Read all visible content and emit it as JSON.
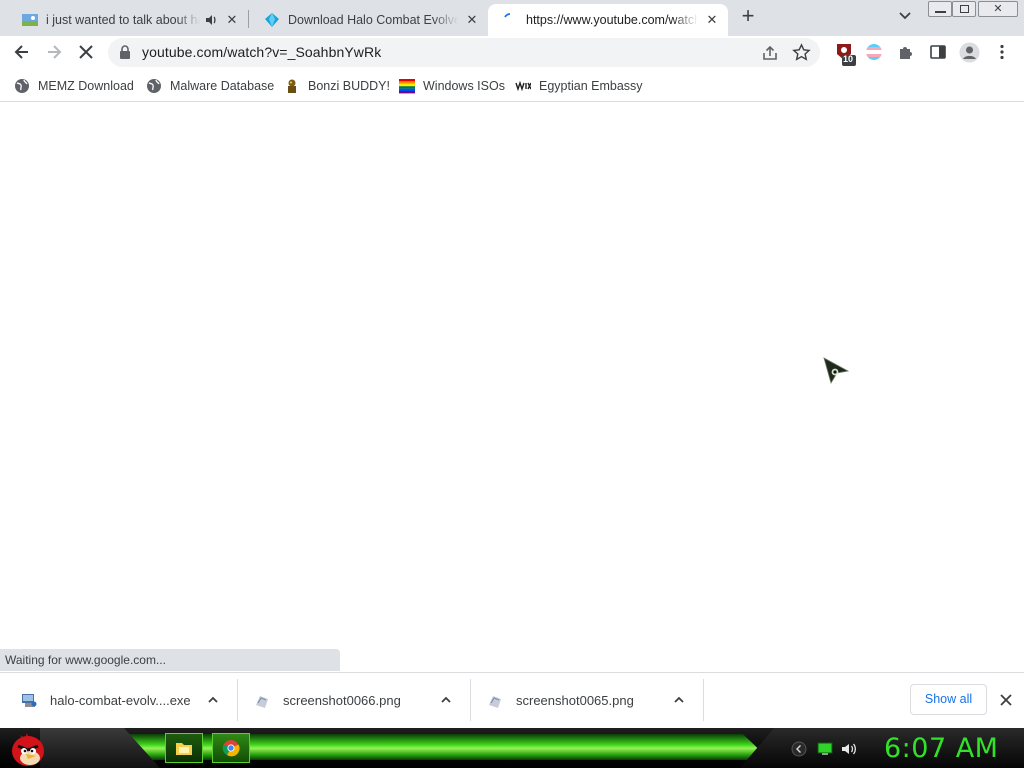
{
  "tabs": [
    {
      "title": "i just wanted to talk about ha",
      "favicon": "landscape-favicon-icon",
      "audio": true
    },
    {
      "title": "Download Halo Combat Evolved",
      "favicon": "blue-diamond-favicon-icon",
      "audio": false
    },
    {
      "title": "https://www.youtube.com/watch",
      "favicon": "loading-spinner-icon",
      "audio": false,
      "active": true
    }
  ],
  "omnibox": {
    "url": "youtube.com/watch?v=_SoahbnYwRk"
  },
  "extensions": {
    "badge_count": "10"
  },
  "bookmarks": [
    {
      "label": "MEMZ Download",
      "icon": "globe-icon"
    },
    {
      "label": "Malware Database",
      "icon": "globe-icon"
    },
    {
      "label": "Bonzi BUDDY!",
      "icon": "bonzi-icon"
    },
    {
      "label": "Windows ISOs",
      "icon": "rainbow-flag-icon"
    },
    {
      "label": "Egyptian Embassy",
      "icon": "wix-icon"
    }
  ],
  "status_bar": {
    "text": "Waiting for www.google.com..."
  },
  "downloads": [
    {
      "name": "halo-combat-evolv....exe",
      "icon": "installer-icon"
    },
    {
      "name": "screenshot0066.png",
      "icon": "image-file-icon"
    },
    {
      "name": "screenshot0065.png",
      "icon": "image-file-icon"
    }
  ],
  "download_shelf": {
    "show_all_label": "Show all"
  },
  "taskbar": {
    "clock": "6:07 AM",
    "accent": "#32e12a"
  }
}
